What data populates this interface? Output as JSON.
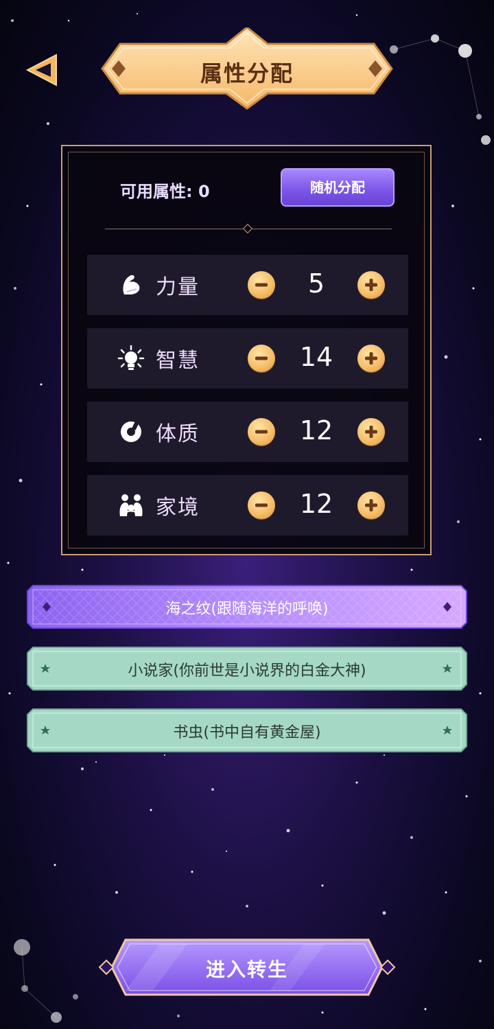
{
  "header": {
    "title": "属性分配"
  },
  "panel": {
    "available_label": "可用属性: 0",
    "random_button": "随机分配",
    "stats": [
      {
        "label": "力量",
        "value": "5",
        "icon": "muscle-icon"
      },
      {
        "label": "智慧",
        "value": "14",
        "icon": "lightbulb-icon"
      },
      {
        "label": "体质",
        "value": "12",
        "icon": "constitution-icon"
      },
      {
        "label": "家境",
        "value": "12",
        "icon": "family-icon"
      }
    ]
  },
  "traits": [
    {
      "text": "海之纹(跟随海洋的呼唤)",
      "style": "purple"
    },
    {
      "text": "小说家(你前世是小说界的白金大神)",
      "style": "green"
    },
    {
      "text": "书虫(书中自有黄金屋)",
      "style": "green"
    }
  ],
  "start_button": "进入转生",
  "colors": {
    "gold": "#f6be6a",
    "purple_button": "#7a54e6",
    "trait_purple": "#b48cff",
    "trait_green": "#a6d8c6",
    "panel_border": "#c9a07a"
  }
}
